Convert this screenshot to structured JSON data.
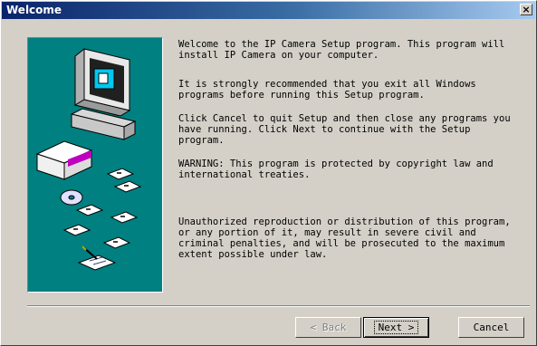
{
  "window": {
    "title": "Welcome",
    "close_label": "×"
  },
  "content": {
    "paragraph1": "Welcome to the IP Camera Setup program. This program will\ninstall IP Camera on your computer.",
    "paragraph2": "It is strongly recommended that you exit all Windows\nprograms before running this Setup program.",
    "paragraph3": "Click Cancel to quit Setup and then close any programs you\nhave running. Click Next to continue with the Setup\nprogram.",
    "paragraph4": "WARNING: This program is protected by copyright law and\ninternational treaties.",
    "paragraph5": "Unauthorized reproduction or distribution of this program,\nor any portion of it, may result in severe civil and\ncriminal penalties, and will be prosecuted to the maximum\nextent possible under law."
  },
  "buttons": {
    "back": "< Back",
    "next": "Next >",
    "cancel": "Cancel"
  },
  "colors": {
    "title_bar": "#0a246a",
    "art_background": "#008080",
    "dialog": "#d4d0c8"
  }
}
